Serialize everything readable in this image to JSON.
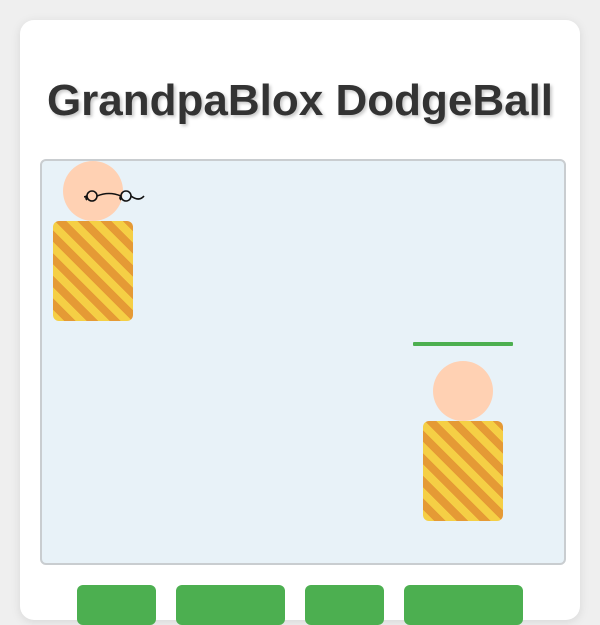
{
  "game": {
    "title": "GrandpaBlox DodgeBall"
  },
  "players": [
    {
      "id": "grandpa",
      "accessory": "glasses-icon",
      "head_color": "#ffd1b3",
      "shirt_colors": [
        "#f5cf45",
        "#e59a35"
      ]
    },
    {
      "id": "opponent",
      "head_color": "#ffd1b3",
      "shirt_colors": [
        "#f5cf45",
        "#e59a35"
      ],
      "health_fraction": 1.0,
      "health_color": "#4caf50"
    }
  ],
  "controls": {
    "buttons": [
      {
        "label": ""
      },
      {
        "label": ""
      },
      {
        "label": ""
      },
      {
        "label": ""
      }
    ],
    "button_color": "#4caf50"
  },
  "colors": {
    "arena_background": "#e8f2f8",
    "arena_border": "#c9cdd0",
    "title_color": "#333333"
  }
}
